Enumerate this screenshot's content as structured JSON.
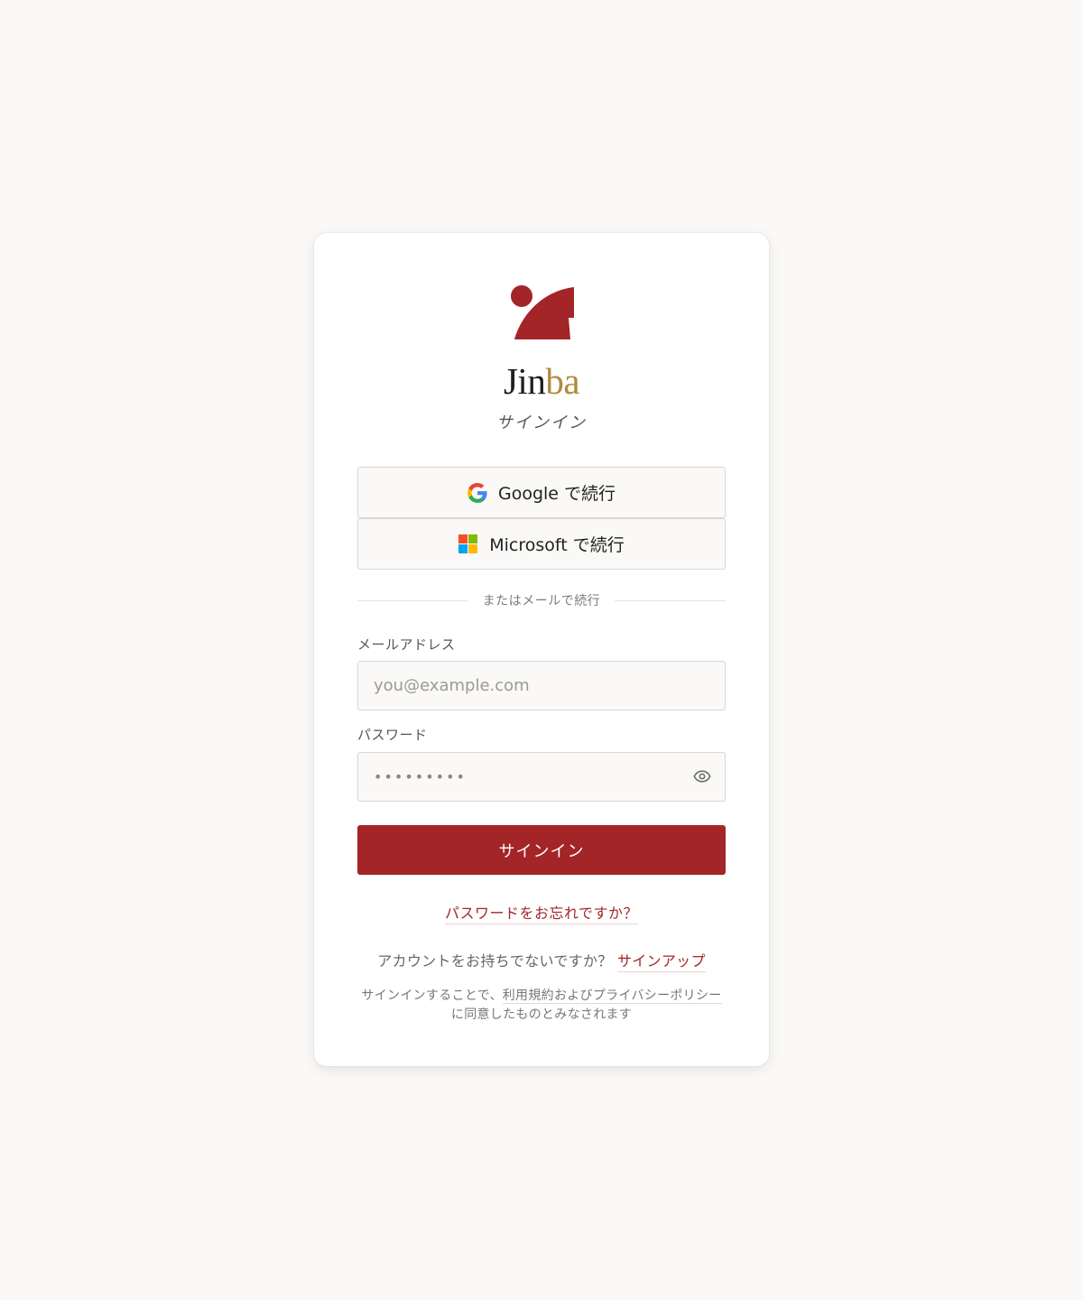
{
  "brand": {
    "name_part1": "Jin",
    "name_part2": "ba",
    "subtitle": "サインイン"
  },
  "oauth": {
    "google_label": "Google で続行",
    "microsoft_label": "Microsoft で続行"
  },
  "divider_text": "またはメールで続行",
  "email": {
    "label": "メールアドレス",
    "placeholder": "you@example.com",
    "value": ""
  },
  "password": {
    "label": "パスワード",
    "value": "•••••••••"
  },
  "signin_button": "サインイン",
  "forgot_password": "パスワードをお忘れですか？",
  "signup": {
    "prompt": "アカウントをお持ちでないですか？",
    "link": "サインアップ"
  },
  "terms": {
    "prefix": "サインインすることで、",
    "link": "利用規約およびプライバシーポリシー",
    "suffix": "に同意したものとみなされます"
  },
  "icons": {
    "logo": "jinba-logo-icon",
    "google": "google-icon",
    "microsoft": "microsoft-icon",
    "eye": "eye-icon"
  },
  "colors": {
    "accent": "#a32528",
    "brand_gold": "#b08a3e",
    "background": "#faf9f7"
  }
}
